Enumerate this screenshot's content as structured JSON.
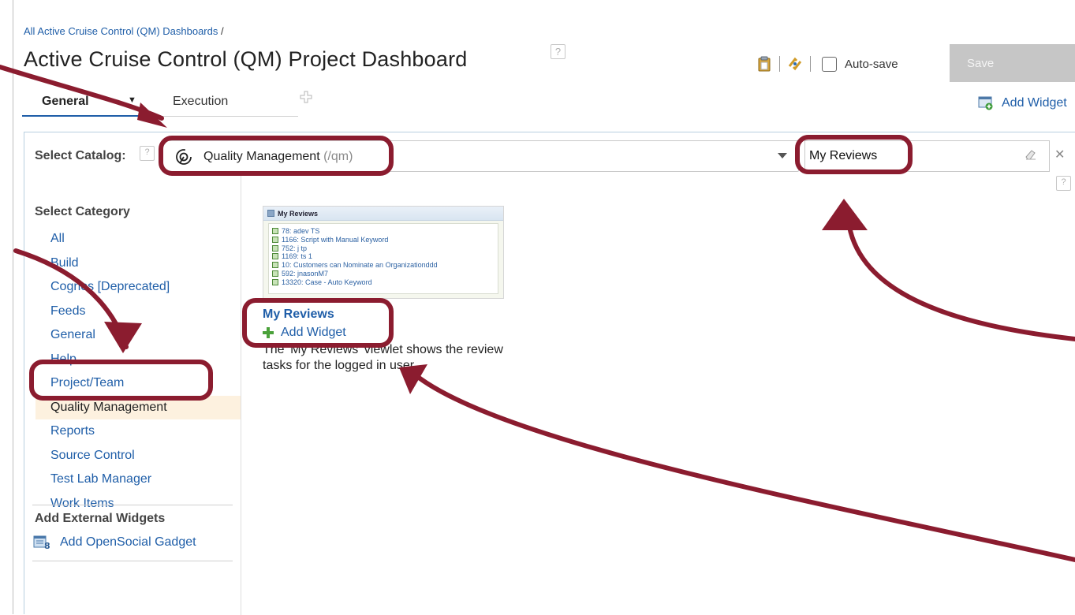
{
  "breadcrumb": {
    "link": "All Active Cruise Control (QM) Dashboards",
    "separator": "/"
  },
  "page": {
    "title": "Active Cruise Control (QM) Project Dashboard"
  },
  "toolbar": {
    "autosave_label": "Auto-save",
    "save_label": "Save",
    "add_widget_label": "Add Widget"
  },
  "tabs": [
    {
      "label": "General",
      "active": true
    },
    {
      "label": "Execution",
      "active": false
    }
  ],
  "catalog": {
    "label": "Select Catalog:",
    "selected_name": "Quality Management",
    "selected_path": "(/qm)"
  },
  "search": {
    "value": "My Reviews"
  },
  "categories": {
    "label": "Select Category",
    "items": [
      "All",
      "Build",
      "Cognos [Deprecated]",
      "Feeds",
      "General",
      "Help",
      "Project/Team",
      "Quality Management",
      "Reports",
      "Source Control",
      "Test Lab Manager",
      "Work Items"
    ],
    "selected": "Quality Management"
  },
  "external": {
    "label": "Add External Widgets",
    "item": "Add OpenSocial Gadget"
  },
  "widget": {
    "thumb_title": "My Reviews",
    "thumb_rows": [
      "78: adev TS",
      "1166: Script with Manual Keyword",
      "752: j tp",
      "1169: ts 1",
      "10: Customers can Nominate an Organizationddd",
      "592: jnasonM7",
      "13320: Case - Auto Keyword"
    ],
    "title": "My Reviews",
    "add_label": "Add Widget",
    "description": "The 'My Reviews' viewlet shows the review tasks for the logged in user."
  },
  "colors": {
    "link": "#1f5ea8",
    "annotation": "#8b1c2f",
    "selected_bg": "#fdf1df"
  }
}
